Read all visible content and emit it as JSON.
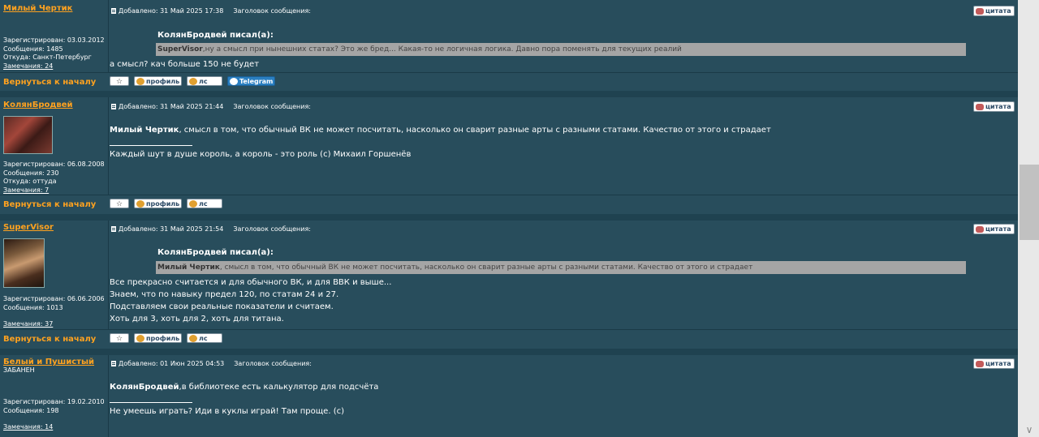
{
  "posts": [
    {
      "username": "Милый Чертик",
      "rank": "",
      "meta": {
        "registered": "Зарегистрирован: 03.03.2012",
        "messages": "Сообщения: 1485",
        "from": "Откуда: Санкт-Петербург",
        "remarks": "Замечания: 24"
      },
      "header": {
        "added": "Добавлено: 31 Май 2025 17:38",
        "subject": "Заголовок сообщения:"
      },
      "quote": {
        "author": "КолянБродвей писал(а):",
        "name": "SuperVisor",
        "text": ",ну а смысл при нынешних статах? Это же бред... Какая-то не логичная логика. Давно пора поменять для текущих реалий"
      },
      "body": [
        "а смысл? кач больше 150 не будет"
      ],
      "signature": "",
      "buttons": {
        "star": "☆",
        "profile": "профиль",
        "pm": "лс",
        "telegram": "Telegram"
      }
    },
    {
      "username": "КолянБродвей",
      "meta": {
        "registered": "Зарегистрирован: 06.08.2008",
        "messages": "Сообщения: 230",
        "from": "Откуда: оттуда",
        "remarks": "Замечания: 7"
      },
      "header": {
        "added": "Добавлено: 31 Май 2025 21:44",
        "subject": "Заголовок сообщения:"
      },
      "body_bold": "Милый Чертик",
      "body_rest": ", смысл в том, что обычный ВК не может посчитать, насколько он сварит разные арты с разными статами. Качество от этого и страдает",
      "signature": "Каждый шут в душе король, а король - это роль (с) Михаил Горшенёв",
      "buttons": {
        "star": "☆",
        "profile": "профиль",
        "pm": "лс"
      }
    },
    {
      "username": "SuperVisor",
      "meta": {
        "registered": "Зарегистрирован: 06.06.2006",
        "messages": "Сообщения: 1013",
        "remarks": "Замечания: 37"
      },
      "header": {
        "added": "Добавлено: 31 Май 2025 21:54",
        "subject": "Заголовок сообщения:"
      },
      "quote": {
        "author": "КолянБродвей писал(а):",
        "name": "Милый Чертик",
        "text": ", смысл в том, что обычный ВК не может посчитать, насколько он сварит разные арты с разными статами. Качество от этого и страдает"
      },
      "body": [
        "Все прекрасно считается и для обычного ВК, и для ВВК и выше...",
        "Знаем, что по навыку предел 120, по статам 24 и 27.",
        "Подставляем свои реальные показатели и считаем.",
        "Хоть для 3, хоть для 2, хоть для титана."
      ],
      "buttons": {
        "star": "☆",
        "profile": "профиль",
        "pm": "лс"
      }
    },
    {
      "username": "Белый и Пушистый",
      "rank": "ЗАБАНЕН",
      "meta": {
        "registered": "Зарегистрирован: 19.02.2010",
        "messages": "Сообщения: 198",
        "remarks": "Замечания: 14"
      },
      "header": {
        "added": "Добавлено: 01 Июн 2025 04:53",
        "subject": "Заголовок сообщения:"
      },
      "body_bold": "КолянБродвей",
      "body_rest": ",в библиотеке есть калькулятор для подсчёта",
      "signature": "Не умеешь играть? Иди в куклы играй! Там проще. (с)"
    }
  ],
  "ui": {
    "back_to_top": "Вернуться к началу",
    "quote_btn": "цитата"
  },
  "colors": {
    "background": "#284d5c",
    "username": "#ffa21f",
    "quote_bg": "#a5a5a5"
  }
}
